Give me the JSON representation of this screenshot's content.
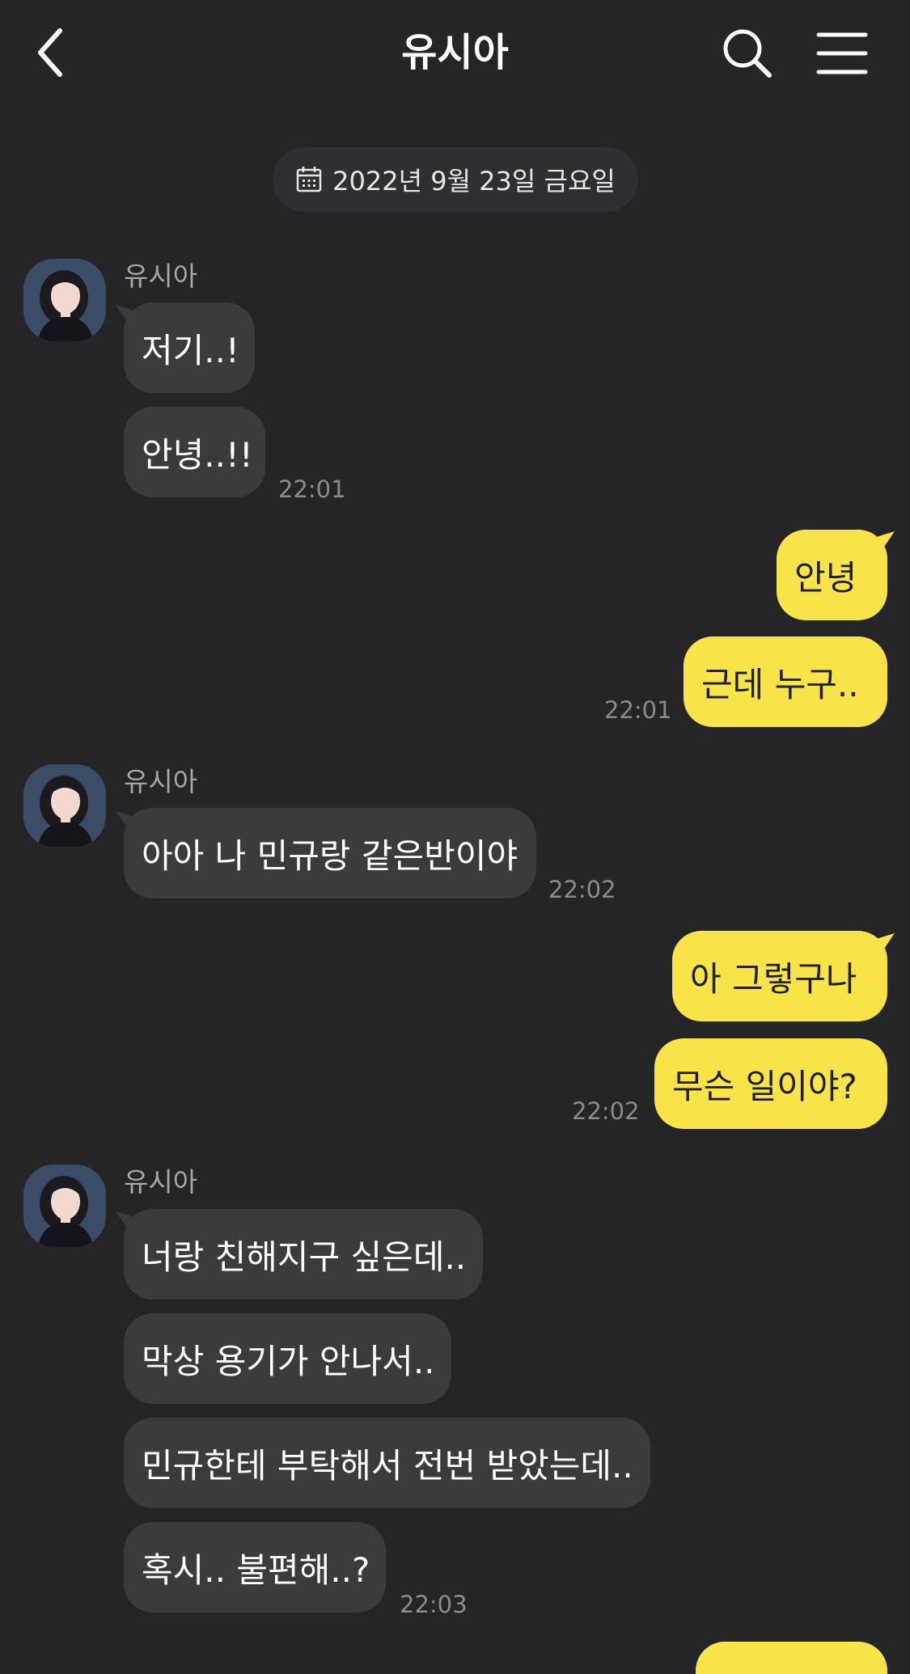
{
  "header": {
    "title": "유시아"
  },
  "date_label": "2022년 9월 23일 금요일",
  "sender_name": "유시아",
  "colors": {
    "background": "#252528",
    "incoming_bubble": "#3b3b3e",
    "outgoing_bubble": "#f8e349"
  },
  "messages": {
    "group1": {
      "m1": "저기..!",
      "m2": "안녕..!!",
      "time": "22:01"
    },
    "group2": {
      "m1": "안녕",
      "m2": "근데 누구..",
      "time": "22:01"
    },
    "group3": {
      "m1": "아아 나 민규랑 같은반이야",
      "time": "22:02"
    },
    "group4": {
      "m1": "아 그렇구나",
      "m2": "무슨 일이야?",
      "time": "22:02"
    },
    "group5": {
      "m1": "너랑 친해지구 싶은데..",
      "m2": "막상 용기가 안나서..",
      "m3": "민규한테 부탁해서 전번 받았는데..",
      "m4": "혹시.. 불편해..?",
      "time": "22:03"
    }
  }
}
